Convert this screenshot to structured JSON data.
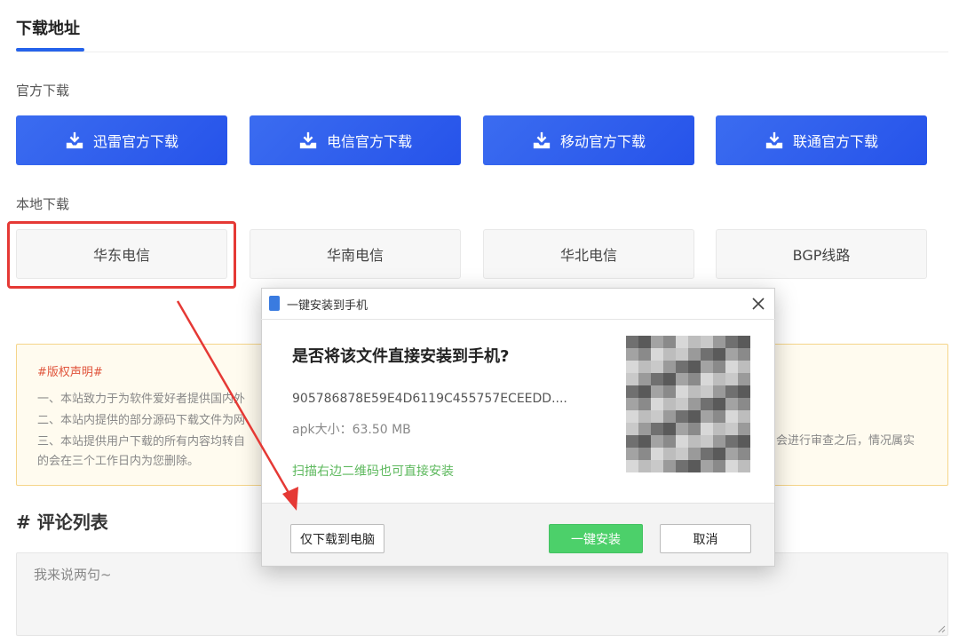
{
  "header": {
    "title": "下载地址"
  },
  "official": {
    "label": "官方下载",
    "buttons": [
      "迅雷官方下载",
      "电信官方下载",
      "移动官方下载",
      "联通官方下载"
    ]
  },
  "local": {
    "label": "本地下载",
    "buttons": [
      "华东电信",
      "华南电信",
      "华北电信",
      "BGP线路"
    ]
  },
  "notice": {
    "title": "#版权声明#",
    "lines": [
      "一、本站致力于为软件爱好者提供国内外",
      "二、本站内提供的部分源码下载文件为网",
      "三、本站提供用户下载的所有内容均转自"
    ],
    "tail": "会进行审查之后，情况属实",
    "end": "的会在三个工作日内为您删除。"
  },
  "comments": {
    "title": "# 评论列表",
    "placeholder": "我来说两句~"
  },
  "dialog": {
    "title": "一键安装到手机",
    "question": "是否将该文件直接安装到手机?",
    "hash": "905786878E59E4D6119C455757ECEEDD....",
    "size": "apk大小：63.50 MB",
    "tip": "扫描右边二维码也可直接安装",
    "btn_local": "仅下载到电脑",
    "btn_install": "一键安装",
    "btn_cancel": "取消"
  },
  "colors": {
    "accent": "#2653ea",
    "annotation": "#e53935",
    "install": "#4cd06a"
  },
  "icons": [
    "download-icon",
    "phone-icon",
    "close-icon",
    "qr-code",
    "resize-handle-icon"
  ]
}
